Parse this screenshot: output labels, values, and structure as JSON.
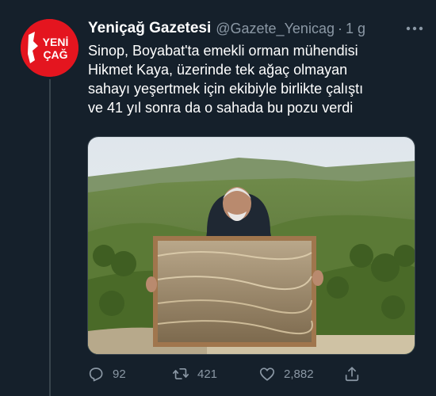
{
  "tweet": {
    "author": {
      "name": "Yeniçağ Gazetesi",
      "handle": "@Gazete_Yenicag",
      "separator": "·",
      "time": "1 g",
      "avatar_text_top": "YENİ",
      "avatar_text_bottom": "ÇAĞ"
    },
    "text_lines": [
      "Sinop, Boyabat'ta emekli orman mühendisi",
      "Hikmet Kaya, üzerinde tek ağaç olmayan",
      "sahayı yeşertmek için ekibiyle birlikte çalıştı",
      "ve 41 yıl sonra da o sahada bu pozu verdi"
    ],
    "actions": {
      "reply_count": "92",
      "retweet_count": "421",
      "like_count": "2,882"
    },
    "icons": {
      "more": "more-dots-icon",
      "reply": "reply-icon",
      "retweet": "retweet-icon",
      "like": "heart-icon",
      "share": "share-icon"
    },
    "colors": {
      "background": "#15202b",
      "secondary_text": "#8b98a5",
      "avatar_red": "#e4151f"
    }
  }
}
